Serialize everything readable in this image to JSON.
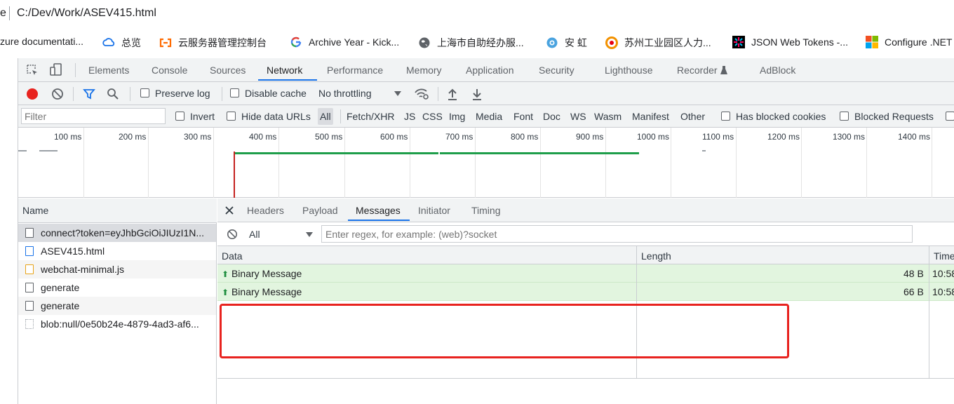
{
  "address_bar": {
    "prefix": "e",
    "url": "C:/Dev/Work/ASEV415.html"
  },
  "bookmarks": [
    {
      "label": "zure documentati...",
      "icon": "none"
    },
    {
      "label": "总览",
      "icon": "cloud-icon"
    },
    {
      "label": "云服务器管理控制台",
      "icon": "aliyun-icon"
    },
    {
      "label": "Archive Year - Kick...",
      "icon": "google-icon"
    },
    {
      "label": "上海市自助经办服...",
      "icon": "globe-icon"
    },
    {
      "label": "安 虹",
      "icon": "site-icon"
    },
    {
      "label": "苏州工业园区人力...",
      "icon": "circle-logo-icon"
    },
    {
      "label": "JSON Web Tokens -...",
      "icon": "jwt-icon"
    },
    {
      "label": "Configure .NET",
      "icon": "microsoft-icon"
    }
  ],
  "devtools": {
    "tabs": [
      "Elements",
      "Console",
      "Sources",
      "Network",
      "Performance",
      "Memory",
      "Application",
      "Security",
      "Lighthouse",
      "Recorder",
      "AdBlock"
    ],
    "active_tab": "Network",
    "toolbar": {
      "preserve_log": "Preserve log",
      "disable_cache": "Disable cache",
      "throttling": "No throttling"
    },
    "filter": {
      "placeholder": "Filter",
      "invert": "Invert",
      "hide_data_urls": "Hide data URLs",
      "types": [
        "All",
        "Fetch/XHR",
        "JS",
        "CSS",
        "Img",
        "Media",
        "Font",
        "Doc",
        "WS",
        "Wasm",
        "Manifest",
        "Other"
      ],
      "has_blocked_cookies": "Has blocked cookies",
      "blocked_requests": "Blocked Requests"
    },
    "timeline": {
      "ticks": [
        "100 ms",
        "200 ms",
        "300 ms",
        "400 ms",
        "500 ms",
        "600 ms",
        "700 ms",
        "800 ms",
        "900 ms",
        "1000 ms",
        "1100 ms",
        "1200 ms",
        "1300 ms",
        "1400 ms"
      ]
    },
    "requests": {
      "header": "Name",
      "items": [
        "connect?token=eyJhbGciOiJIUzI1N...",
        "ASEV415.html",
        "webchat-minimal.js",
        "generate",
        "generate",
        "blob:null/0e50b24e-4879-4ad3-af6..."
      ]
    },
    "detail": {
      "tabs": [
        "Headers",
        "Payload",
        "Messages",
        "Initiator",
        "Timing"
      ],
      "active_tab": "Messages",
      "filter_select": "All",
      "regex_placeholder": "Enter regex, for example: (web)?socket",
      "columns": [
        "Data",
        "Length",
        "Time"
      ],
      "messages": [
        {
          "data": "Binary Message",
          "length": "48 B",
          "time": "10:58"
        },
        {
          "data": "Binary Message",
          "length": "66 B",
          "time": "10:58"
        }
      ]
    }
  },
  "colors": {
    "accent": "#1a73e8",
    "record": "#e8231f",
    "message_bg": "#e2f5df",
    "highlight": "#e8231f"
  }
}
